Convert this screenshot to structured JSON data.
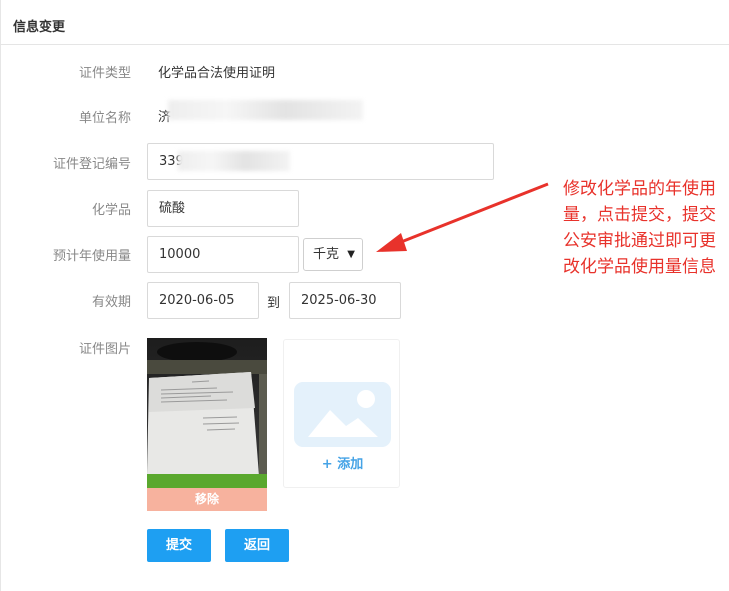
{
  "header": {
    "title": "信息变更"
  },
  "form": {
    "cert_type": {
      "label": "证件类型",
      "value": "化学品合法使用证明"
    },
    "unit_name": {
      "label": "单位名称",
      "value_visible": "济"
    },
    "cert_number": {
      "label": "证件登记编号",
      "value_visible": "339"
    },
    "chemical": {
      "label": "化学品",
      "value": "硫酸"
    },
    "annual_usage": {
      "label": "预计年使用量",
      "value": "10000",
      "unit": "千克"
    },
    "validity": {
      "label": "有效期",
      "start": "2020-06-05",
      "separator": "到",
      "end": "2025-06-30"
    },
    "cert_image": {
      "label": "证件图片",
      "remove_label": "移除",
      "add_label": "+ 添加"
    }
  },
  "buttons": {
    "submit": "提交",
    "back": "返回"
  },
  "annotation": {
    "text": "修改化学品的年使用量，点击提交，提交公安审批通过即可更改化学品使用量信息"
  },
  "colors": {
    "primary": "#1e9ff2",
    "remove": "#f7b29e",
    "annotation": "#e8322b"
  }
}
